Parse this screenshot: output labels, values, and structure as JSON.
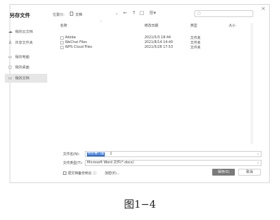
{
  "dialog": {
    "title": "另存文件",
    "close_glyph": "×"
  },
  "sidebar": {
    "items": [
      {
        "label": "我的云文档",
        "icon": "cloud-icon"
      },
      {
        "label": "共享文件夹",
        "icon": "shared-users-icon"
      },
      {
        "label": "我的电脑",
        "icon": "computer-icon"
      },
      {
        "label": "我的桌面",
        "icon": "desktop-icon"
      },
      {
        "label": "我的文档",
        "icon": "folder-icon",
        "active": true
      }
    ]
  },
  "toolbar": {
    "location_label": "位置(I):",
    "location_value": "文档",
    "location_icon": "document-icon",
    "back_glyph": "←",
    "up_glyph": "↑",
    "new_folder_glyph": "□",
    "view_glyph": "☰▾",
    "search_placeholder": ""
  },
  "columns": {
    "name": "名称",
    "date": "修改日期",
    "type": "类型",
    "size": "大小"
  },
  "files": [
    {
      "name": "Adobe",
      "date": "2021/5/3 18:44",
      "type": "文件夹",
      "size": ""
    },
    {
      "name": "WeChat Files",
      "date": "2021/8/14 14:40",
      "type": "文件夹",
      "size": ""
    },
    {
      "name": "WPS Cloud Files",
      "date": "2021/5/28 17:53",
      "type": "文件夹",
      "size": ""
    }
  ],
  "filename": {
    "label": "文件名(N):",
    "value": "倒装端口器"
  },
  "filetype": {
    "label": "文件类型(T):",
    "value": "Microsoft Word 文件(*.docx)"
  },
  "options": {
    "checkbox_label": "把文档备份到云",
    "hint": "",
    "tools": "加密(E)..."
  },
  "buttons": {
    "save": "保存(S)",
    "cancel": "取消"
  },
  "caption": "图1−4"
}
